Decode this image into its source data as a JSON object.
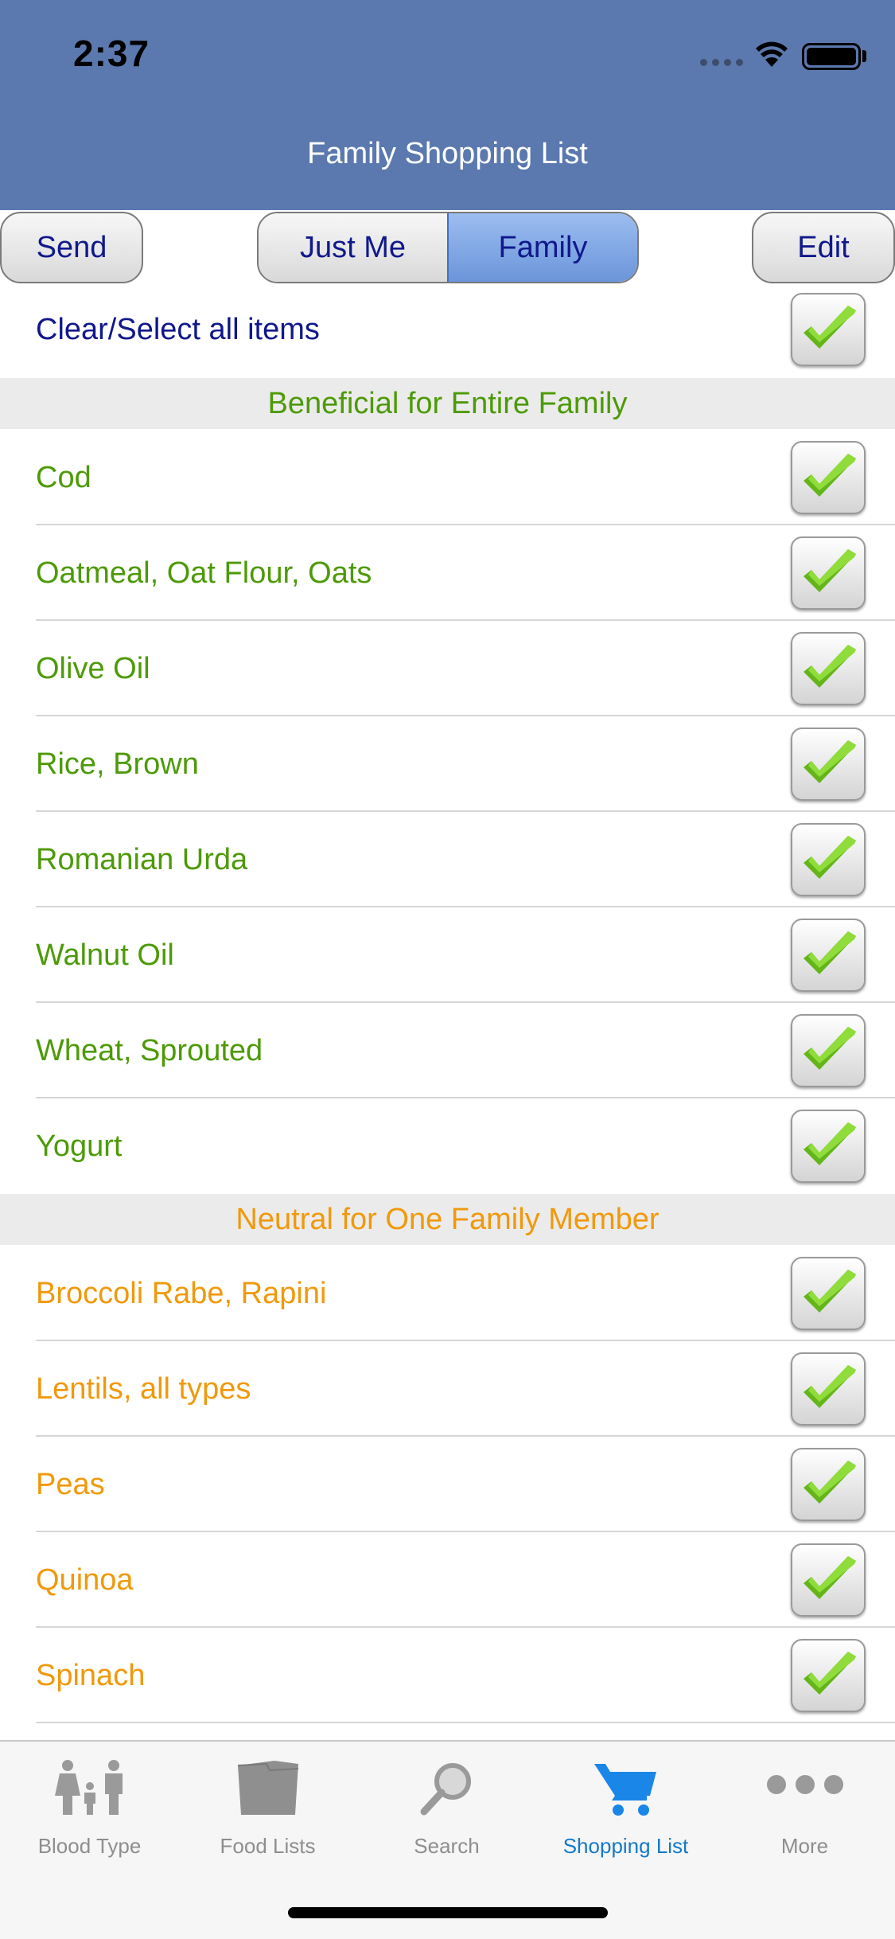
{
  "status_bar": {
    "time": "2:37"
  },
  "nav": {
    "title": "Family Shopping List"
  },
  "toolbar": {
    "send_label": "Send",
    "edit_label": "Edit",
    "segments": [
      {
        "label": "Just Me",
        "selected": false
      },
      {
        "label": "Family",
        "selected": true
      }
    ]
  },
  "select_all": {
    "label": "Clear/Select all items",
    "checked": true
  },
  "sections": [
    {
      "title": "Beneficial for Entire Family",
      "color": "#4d9a07",
      "items": [
        {
          "label": "Cod",
          "checked": true
        },
        {
          "label": "Oatmeal, Oat Flour, Oats",
          "checked": true
        },
        {
          "label": "Olive Oil",
          "checked": true
        },
        {
          "label": "Rice, Brown",
          "checked": true
        },
        {
          "label": "Romanian Urda",
          "checked": true
        },
        {
          "label": "Walnut Oil",
          "checked": true
        },
        {
          "label": "Wheat, Sprouted",
          "checked": true
        },
        {
          "label": "Yogurt",
          "checked": true
        }
      ]
    },
    {
      "title": "Neutral for One Family Member",
      "color": "#f0990b",
      "items": [
        {
          "label": "Broccoli Rabe, Rapini",
          "checked": true
        },
        {
          "label": "Lentils, all types",
          "checked": true
        },
        {
          "label": "Peas",
          "checked": true
        },
        {
          "label": "Quinoa",
          "checked": true
        },
        {
          "label": "Spinach",
          "checked": true
        }
      ]
    }
  ],
  "tabbar": {
    "tabs": [
      {
        "label": "Blood Type",
        "icon": "family-icon",
        "active": false
      },
      {
        "label": "Food Lists",
        "icon": "folder-icon",
        "active": false
      },
      {
        "label": "Search",
        "icon": "magnifier-icon",
        "active": false
      },
      {
        "label": "Shopping List",
        "icon": "cart-icon",
        "active": true
      },
      {
        "label": "More",
        "icon": "more-dots-icon",
        "active": false
      }
    ]
  },
  "colors": {
    "nav_bar": "#5b79ae",
    "accent_tab": "#1479c9",
    "button_text": "#10188c"
  }
}
